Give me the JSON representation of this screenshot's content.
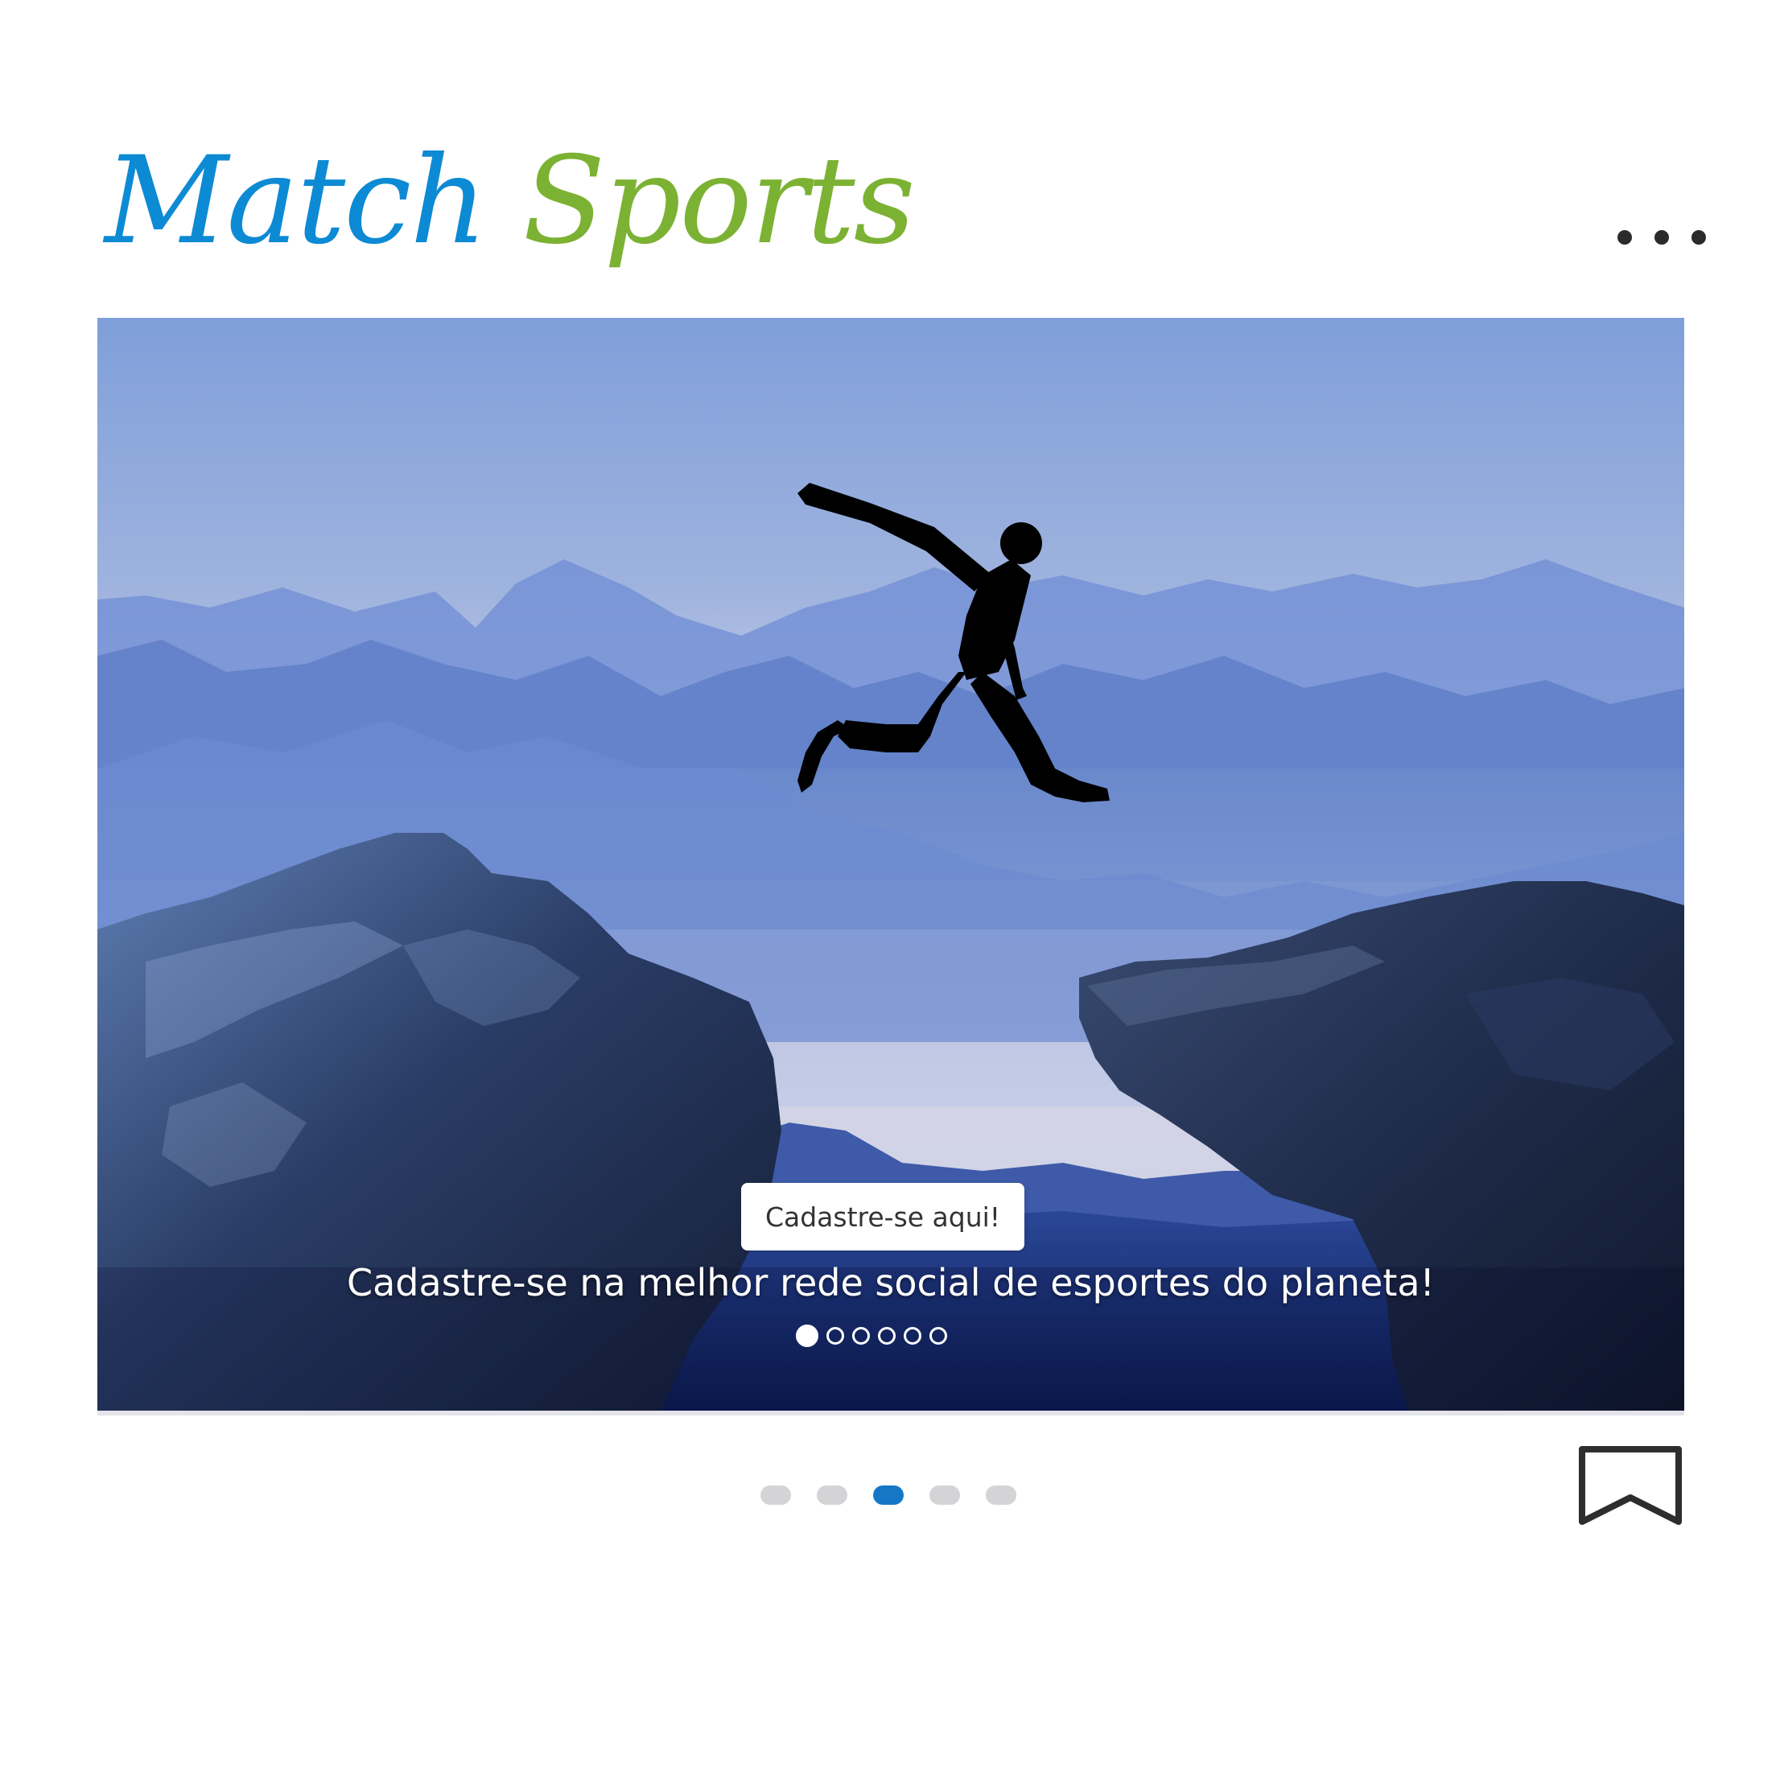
{
  "header": {
    "logo_word_1": "Match",
    "logo_word_2": "Sports",
    "more_icon": "more-horizontal-icon"
  },
  "post": {
    "cta_label": "Cadastre-se aqui!",
    "caption": "Cadastre-se na melhor rede social de esportes do planeta!",
    "inner_slides": {
      "count": 6,
      "active_index": 0
    }
  },
  "footer": {
    "pager": {
      "count": 5,
      "active_index": 2
    },
    "bookmark_icon": "bookmark-icon"
  },
  "colors": {
    "logo_blue": "#0d8ad4",
    "logo_green": "#7cb233",
    "pager_active": "#1677c7",
    "pager_inactive": "#d4d4d6"
  }
}
